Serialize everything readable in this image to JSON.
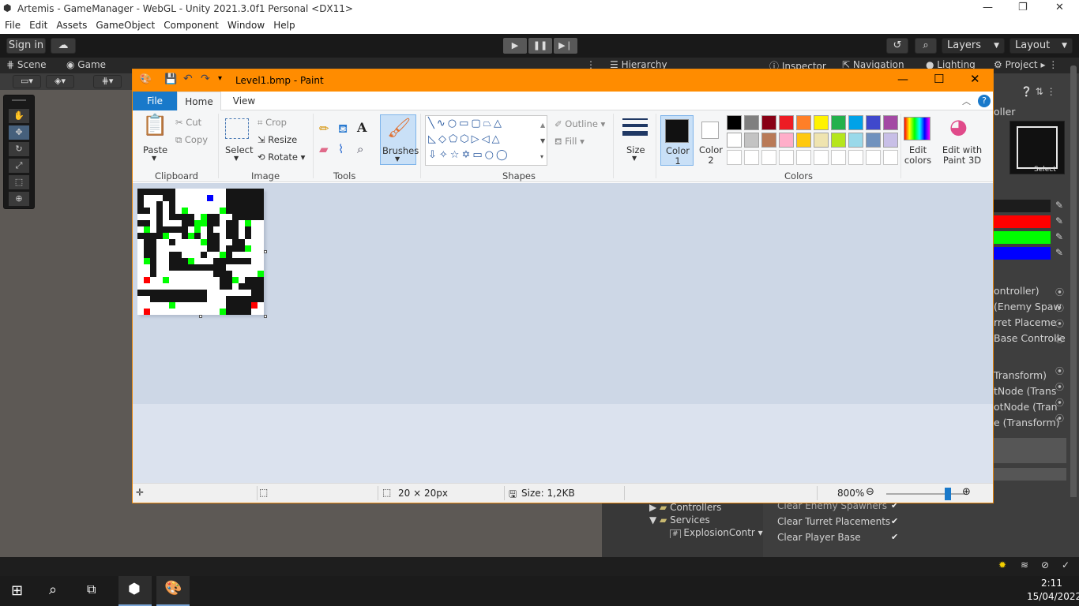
{
  "unity": {
    "window_title": "Artemis - GameManager - WebGL - Unity 2021.3.0f1 Personal <DX11>",
    "menu": [
      "File",
      "Edit",
      "Assets",
      "GameObject",
      "Component",
      "Window",
      "Help"
    ],
    "sign_in": "Sign in",
    "layers": "Layers",
    "layout": "Layout",
    "tabs_left": [
      "Scene",
      "Game"
    ],
    "tabs_right": [
      "Hierarchy",
      "Inspector",
      "Navigation",
      "Lighting",
      "Project"
    ],
    "hierarchy_items": [
      "Controllers",
      "Services",
      "ExplosionContr"
    ],
    "inspector_partial": [
      "ontroller)",
      "(Enemy Spaw",
      "rret Placeme",
      "Base Controlle",
      "Transform)",
      "tNode (Trans",
      "otNode (Tran",
      "e (Transform)"
    ],
    "inspector_checks": [
      "Clear Enemy Spawners",
      "Clear Turret Placements",
      "Clear Player Base"
    ],
    "select_label": "Select",
    "oller_label": "oller",
    "swatch_colors": [
      "#1c1c1c",
      "#ff0000",
      "#00ff00",
      "#0000ff"
    ]
  },
  "paint": {
    "title": "Level1.bmp - Paint",
    "tabs": [
      "File",
      "Home",
      "View"
    ],
    "clipboard": {
      "paste": "Paste",
      "cut": "Cut",
      "copy": "Copy",
      "label": "Clipboard"
    },
    "image": {
      "select": "Select",
      "crop": "Crop",
      "resize": "Resize",
      "rotate": "Rotate",
      "label": "Image"
    },
    "tools_label": "Tools",
    "brushes": "Brushes",
    "shapes": {
      "outline": "Outline",
      "fill": "Fill",
      "label": "Shapes"
    },
    "size": "Size",
    "color1": "Color 1",
    "color2": "Color 2",
    "colors_label": "Colors",
    "edit_colors": "Edit colors",
    "edit_paint3d": "Edit with Paint 3D",
    "palette_row1": [
      "#000000",
      "#7f7f7f",
      "#880015",
      "#ed1c24",
      "#ff7f27",
      "#fff200",
      "#22b14c",
      "#00a2e8",
      "#3f48cc",
      "#a349a4"
    ],
    "palette_row2": [
      "#ffffff",
      "#c3c3c3",
      "#b97a57",
      "#ffaec9",
      "#ffc90e",
      "#efe4b0",
      "#b5e61d",
      "#99d9ea",
      "#7092be",
      "#c8bfe7"
    ],
    "status": {
      "dimensions": "20 × 20px",
      "size": "Size: 1,2KB",
      "zoom": "800%"
    }
  },
  "taskbar": {
    "time": "2:11",
    "date": "15/04/2022"
  }
}
